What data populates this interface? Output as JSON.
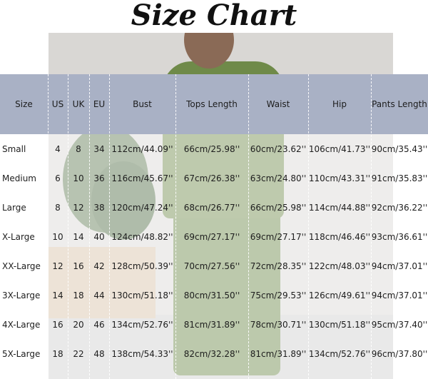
{
  "title": "Size Chart",
  "colors": {
    "header_band": "#a9b1c5",
    "text": "#1d1d1d"
  },
  "table": {
    "headers": [
      "Size",
      "US",
      "UK",
      "EU",
      "Bust",
      "Tops Length",
      "Waist",
      "Hip",
      "Pants Length"
    ],
    "rows": [
      [
        "Small",
        "4",
        "8",
        "34",
        "112cm/44.09''",
        "66cm/25.98''",
        "60cm/23.62''",
        "106cm/41.73''",
        "90cm/35.43''"
      ],
      [
        "Medium",
        "6",
        "10",
        "36",
        "116cm/45.67''",
        "67cm/26.38''",
        "63cm/24.80''",
        "110cm/43.31''",
        "91cm/35.83''"
      ],
      [
        "Large",
        "8",
        "12",
        "38",
        "120cm/47.24''",
        "68cm/26.77''",
        "66cm/25.98''",
        "114cm/44.88''",
        "92cm/36.22''"
      ],
      [
        "X-Large",
        "10",
        "14",
        "40",
        "124cm/48.82''",
        "69cm/27.17''",
        "69cm/27.17''",
        "118cm/46.46''",
        "93cm/36.61''"
      ],
      [
        "XX-Large",
        "12",
        "16",
        "42",
        "128cm/50.39''",
        "70cm/27.56''",
        "72cm/28.35''",
        "122cm/48.03''",
        "94cm/37.01''"
      ],
      [
        "3X-Large",
        "14",
        "18",
        "44",
        "130cm/51.18''",
        "80cm/31.50''",
        "75cm/29.53''",
        "126cm/49.61''",
        "94cm/37.01''"
      ],
      [
        "4X-Large",
        "16",
        "20",
        "46",
        "134cm/52.76''",
        "81cm/31.89''",
        "78cm/30.71''",
        "130cm/51.18''",
        "95cm/37.40''"
      ],
      [
        "5X-Large",
        "18",
        "22",
        "48",
        "138cm/54.33''",
        "82cm/32.28''",
        "81cm/31.89''",
        "134cm/52.76''",
        "96cm/37.80''"
      ]
    ]
  }
}
